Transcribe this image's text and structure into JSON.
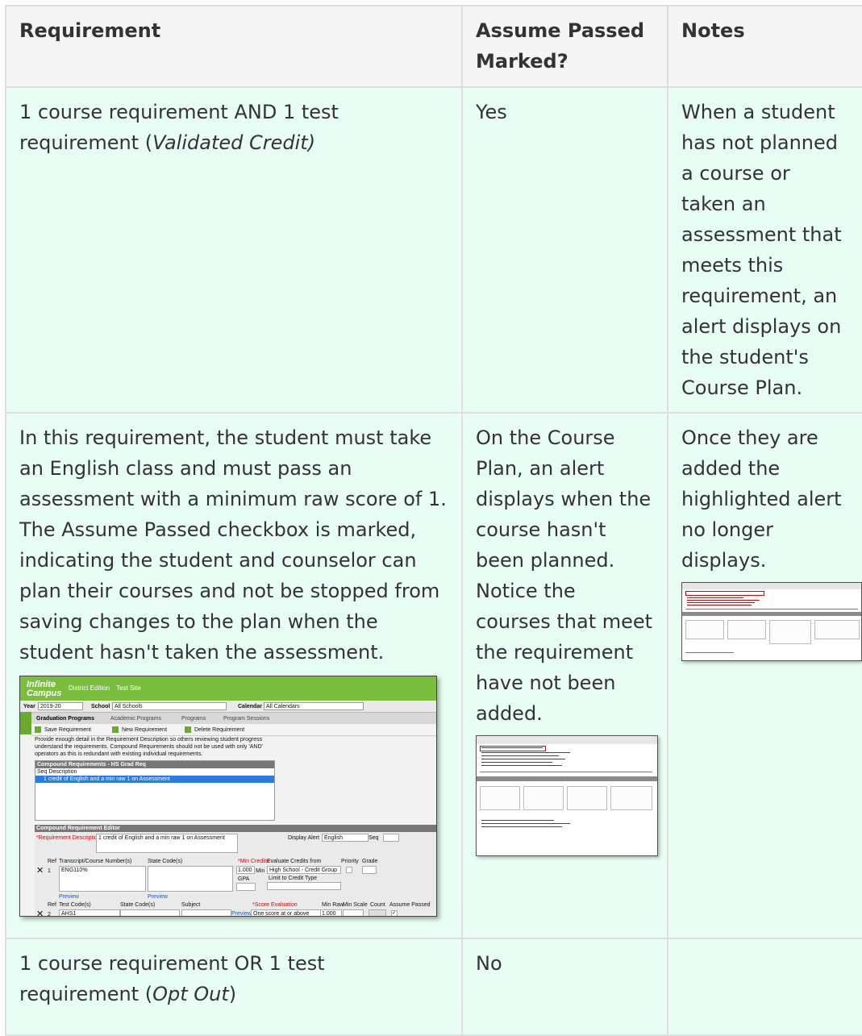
{
  "headers": {
    "requirement": "Requirement",
    "assume_passed": "Assume Passed Marked?",
    "notes": "Notes"
  },
  "rows": [
    {
      "requirement_text": "1 course requirement AND 1 test requirement (",
      "requirement_emph": "Validated Credit)",
      "requirement_tail": "",
      "assume_passed": "Yes",
      "notes": "When a student has not planned a course or taken an assessment that meets this requirement, an alert displays on the student's Course Plan."
    },
    {
      "requirement_text": "In this requirement, the student must take an English class and must pass an assessment with a minimum raw score of 1. The Assume Passed checkbox is marked, indicating the student and counselor can plan their courses and not be stopped from saving changes to the plan when the student hasn't taken the assessment.",
      "assume_passed": "On the Course Plan, an alert displays when the course hasn't been planned. Notice the courses that meet the requirement have not been added.",
      "notes": "Once they are added the highlighted alert no longer displays."
    },
    {
      "requirement_text": "1 course requirement OR 1 test requirement (",
      "requirement_emph": "Opt Out",
      "requirement_tail": ")",
      "assume_passed": "No",
      "notes": ""
    }
  ],
  "screenshot": {
    "brand_top": "Infinite",
    "brand_bottom": "Campus",
    "edition": "District Edition",
    "site": "Test Site",
    "year_label": "Year",
    "year_value": "2019-20",
    "school_label": "School",
    "school_value": "All Schools",
    "calendar_label": "Calendar",
    "calendar_value": "All Calendars",
    "tabs": [
      "Graduation Programs",
      "Academic Programs",
      "Programs",
      "Program Sessions"
    ],
    "save_btn": "Save Requirement",
    "new_btn": "New Requirement",
    "delete_btn": "Delete Requirement",
    "desc_text": "Provide enough detail in the Requirement Description so others reviewing student progress understand the requirements. Compound Requirements should not be used with only 'AND' operators as this is redundant with existing individual requirements.",
    "list_header": "Compound Requirements - HS Grad Req",
    "list_cols": "Seq  Description",
    "list_selected": "1 credit of English and a min raw 1 on Assessment",
    "editor_header": "Compound Requirement Editor",
    "req_desc_label": "*Requirement Description",
    "req_desc_value": "1 credit of English and a min raw 1 on Assessment",
    "display_alert_label": "Display Alert",
    "display_alert_value": "English",
    "seq_label": "Seq",
    "ref_label": "Ref",
    "course_col": "Transcript/Course Number(s)",
    "state_col": "State Code(s)",
    "min_credits": "*Min Credits",
    "evaluate_from": "Evaluate Credits from",
    "priority": "Priority",
    "grade": "Grade",
    "row1_ref": "1",
    "row1_course": "ENG110%",
    "row1_min": "1.000",
    "min_label": "Min",
    "gpa_label": "GPA",
    "row1_eval": "High School - Credit Group",
    "limit_label": "Limit to Credit Type",
    "preview": "Preview",
    "test_col": "Test Code(s)",
    "subject_col": "Subject",
    "score_eval": "*Score Evaluation",
    "min_raw": "Min Raw",
    "min_scale": "Min Scale",
    "count": "Count",
    "assume_passed_col": "Assume Passed",
    "row2_ref": "2",
    "row2_test": "AHS1",
    "row2_eval": "One score at or above",
    "row2_raw": "1.000"
  }
}
